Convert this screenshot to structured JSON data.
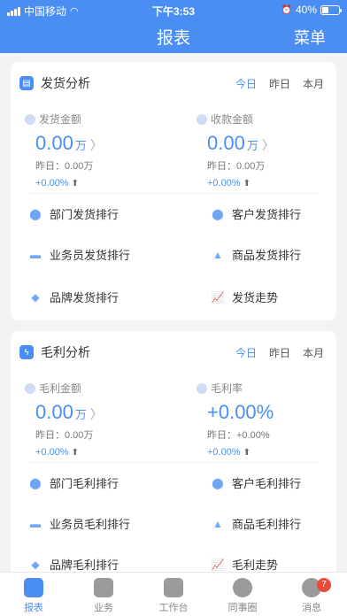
{
  "status_bar": {
    "carrier": "中国移动",
    "time": "下午3:53",
    "battery": "40%",
    "battery_level": 0.4
  },
  "nav": {
    "title": "报表",
    "menu": "菜单"
  },
  "shipping": {
    "title": "发货分析",
    "tabs": [
      "今日",
      "昨日",
      "本月"
    ],
    "active_tab": "今日",
    "stats": [
      {
        "label": "发货金额",
        "value": "0.00",
        "unit": "万",
        "yesterday": "昨日：0.00万",
        "change": "+0.00%"
      },
      {
        "label": "收款金额",
        "value": "0.00",
        "unit": "万",
        "yesterday": "昨日：0.00万",
        "change": "+0.00%"
      }
    ],
    "items": [
      "部门发货排行",
      "客户发货排行",
      "业务员发货排行",
      "商品发货排行",
      "品牌发货排行",
      "发货走势"
    ]
  },
  "profit": {
    "title": "毛利分析",
    "tabs": [
      "今日",
      "昨日",
      "本月"
    ],
    "active_tab": "今日",
    "stats": [
      {
        "label": "毛利金额",
        "value": "0.00",
        "unit": "万",
        "yesterday": "昨日：0.00万",
        "change": "+0.00%"
      },
      {
        "label": "毛利率",
        "value": "+0.00%",
        "unit": "",
        "yesterday": "昨日：+0.00%",
        "change": "+0.00%"
      }
    ],
    "items": [
      "部门毛利排行",
      "客户毛利排行",
      "业务员毛利排行",
      "商品毛利排行",
      "品牌毛利排行",
      "毛利走势"
    ]
  },
  "tabbar": {
    "items": [
      "报表",
      "业务",
      "工作台",
      "同事圈",
      "消息"
    ],
    "active": "报表",
    "message_badge": "7"
  }
}
